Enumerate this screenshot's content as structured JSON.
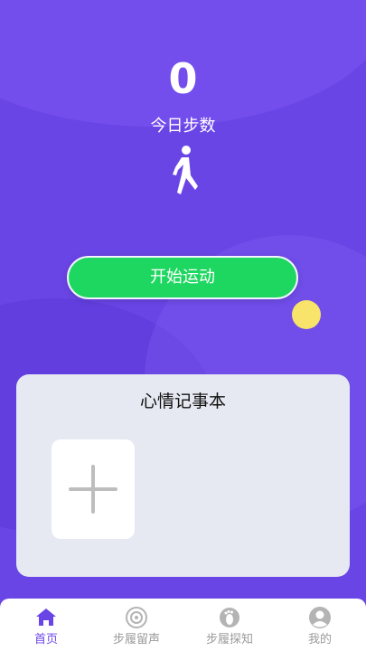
{
  "home": {
    "step_count": "0",
    "step_label": "今日步数",
    "start_button": "开始运动"
  },
  "mood_journal": {
    "title": "心情记事本"
  },
  "tabbar": {
    "items": [
      {
        "label": "首页",
        "icon": "home-icon",
        "active": true
      },
      {
        "label": "步履留声",
        "icon": "disc-icon",
        "active": false
      },
      {
        "label": "步履探知",
        "icon": "footprint-icon",
        "active": false
      },
      {
        "label": "我的",
        "icon": "user-icon",
        "active": false
      }
    ]
  },
  "colors": {
    "background": "#6a45e6",
    "start_button": "#1ed760",
    "accent_yellow": "#f8e36b",
    "tab_active": "#6a45e6",
    "tab_inactive": "#9a9a9a"
  }
}
